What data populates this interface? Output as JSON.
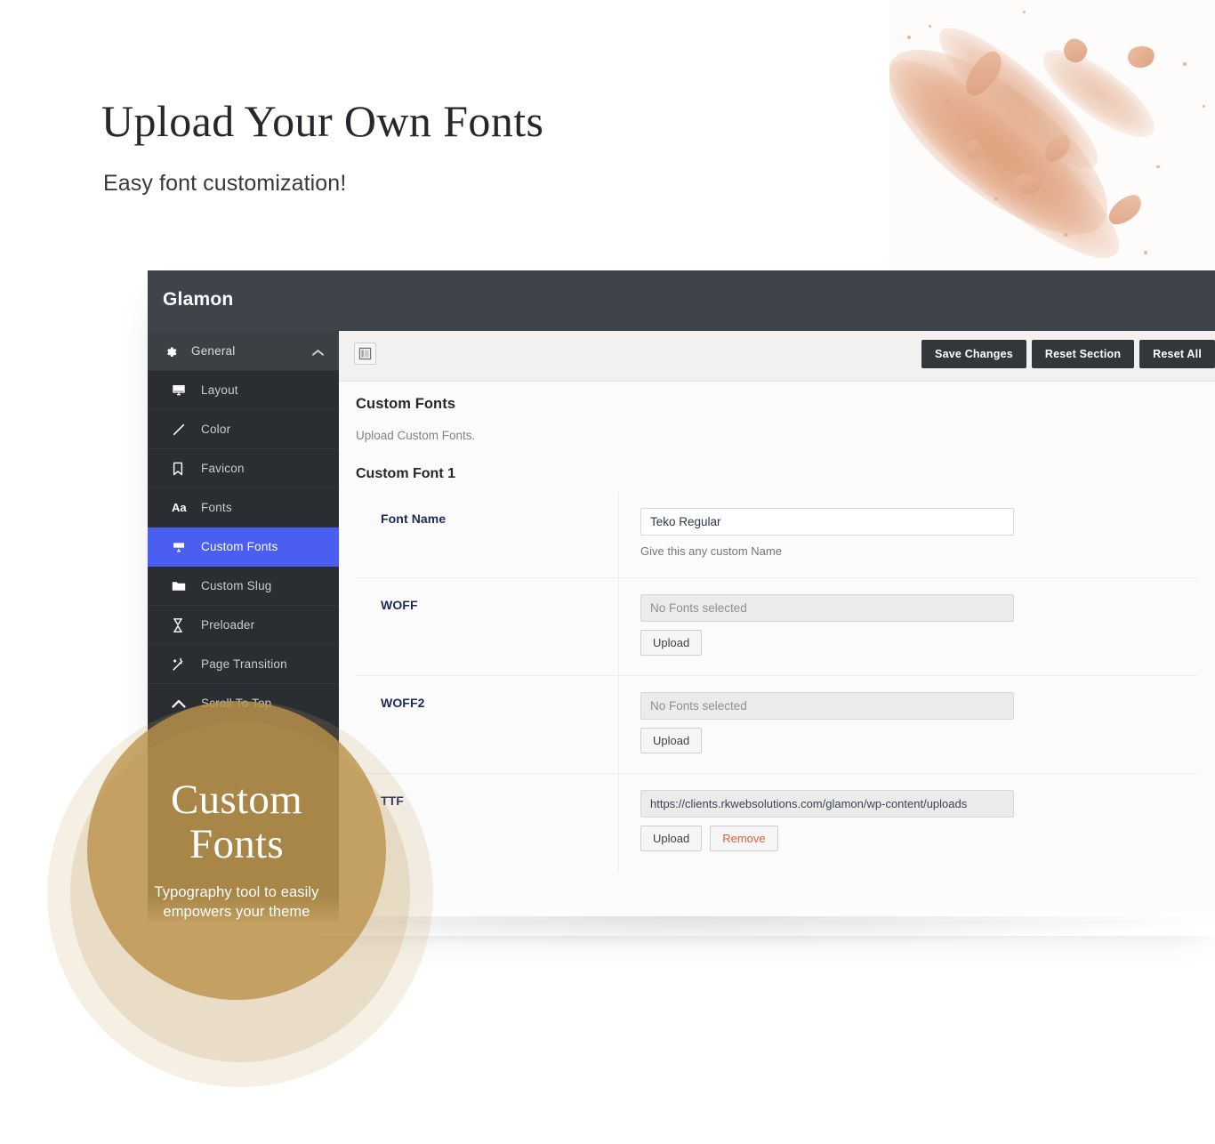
{
  "hero": {
    "title": "Upload Your Own Fonts",
    "subtitle": "Easy font customization!"
  },
  "panel": {
    "brand": "Glamon",
    "sidebar": {
      "group": {
        "label": "General",
        "icon": "gear-icon",
        "chevron": "chevron-up-icon"
      },
      "items": [
        {
          "label": "Layout",
          "icon": "monitor-icon",
          "active": false
        },
        {
          "label": "Color",
          "icon": "pencil-icon",
          "active": false
        },
        {
          "label": "Favicon",
          "icon": "bookmark-icon",
          "active": false
        },
        {
          "label": "Fonts",
          "icon": "aa-text-icon",
          "active": false
        },
        {
          "label": "Custom Fonts",
          "icon": "monitor-icon",
          "active": true
        },
        {
          "label": "Custom Slug",
          "icon": "folder-icon",
          "active": false
        },
        {
          "label": "Preloader",
          "icon": "hourglass-icon",
          "active": false
        },
        {
          "label": "Page Transition",
          "icon": "magic-wand-icon",
          "active": false
        },
        {
          "label": "Scroll To Top",
          "icon": "chevron-up-icon",
          "active": false
        }
      ]
    },
    "toolbar": {
      "toggle_icon": "sidebar-toggle-icon",
      "save_label": "Save Changes",
      "reset_section_label": "Reset Section",
      "reset_all_label": "Reset All"
    },
    "content": {
      "section_title": "Custom Fonts",
      "section_description": "Upload Custom Fonts.",
      "group_title": "Custom Font 1",
      "rows": [
        {
          "label": "Font Name",
          "value": "Teko Regular",
          "placeholder": "",
          "help": "Give this any custom Name",
          "buttons": []
        },
        {
          "label": "WOFF",
          "value": "",
          "placeholder": "No Fonts selected",
          "help": "",
          "buttons": [
            "Upload"
          ]
        },
        {
          "label": "WOFF2",
          "value": "",
          "placeholder": "No Fonts selected",
          "help": "",
          "buttons": [
            "Upload"
          ]
        },
        {
          "label": "TTF",
          "value": "https://clients.rkwebsolutions.com/glamon/wp-content/uploads",
          "placeholder": "",
          "help": "",
          "buttons": [
            "Upload",
            "Remove"
          ]
        }
      ]
    }
  },
  "badge": {
    "title_line1": "Custom",
    "title_line2": "Fonts",
    "subtitle_line1": "Typography tool to easily",
    "subtitle_line2": "empowers your theme"
  },
  "colors": {
    "panel_header": "#3e4449",
    "sidebar": "#2a2e32",
    "active_item": "#4a5ef0",
    "label_navy": "#1b2a5b",
    "danger": "#e0603a",
    "badge_gold": "#ba924a",
    "powder": "#de9f7c"
  }
}
